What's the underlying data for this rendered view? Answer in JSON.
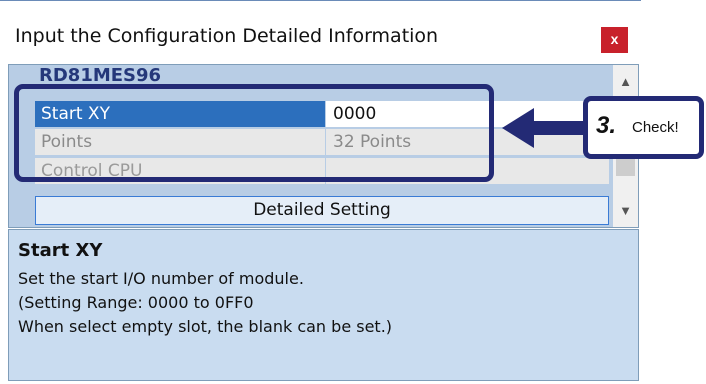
{
  "dialog": {
    "title": "Input the Configuration Detailed Information",
    "close_label": "x"
  },
  "grid": {
    "module_name": "RD81MES96",
    "rows": [
      {
        "label": "Start XY",
        "value": "0000",
        "state": "selected"
      },
      {
        "label": "Points",
        "value": "32 Points",
        "state": "disabled"
      },
      {
        "label": "Control CPU",
        "value": "",
        "state": "disabled"
      }
    ],
    "detail_button": "Detailed Setting",
    "scroll_up": "▲",
    "scroll_down": "▼"
  },
  "description": {
    "title": "Start XY",
    "lines": [
      "Set the start I/O number of module.",
      "(Setting Range: 0000 to 0FF0",
      "When select empty slot, the blank can be set.)"
    ]
  },
  "callout": {
    "number": "3.",
    "text": "Check!"
  },
  "colors": {
    "selected_row": "#2c6fbd",
    "highlight": "#232a75",
    "close_button": "#c8212b",
    "description_bg": "#c9dcf0"
  }
}
